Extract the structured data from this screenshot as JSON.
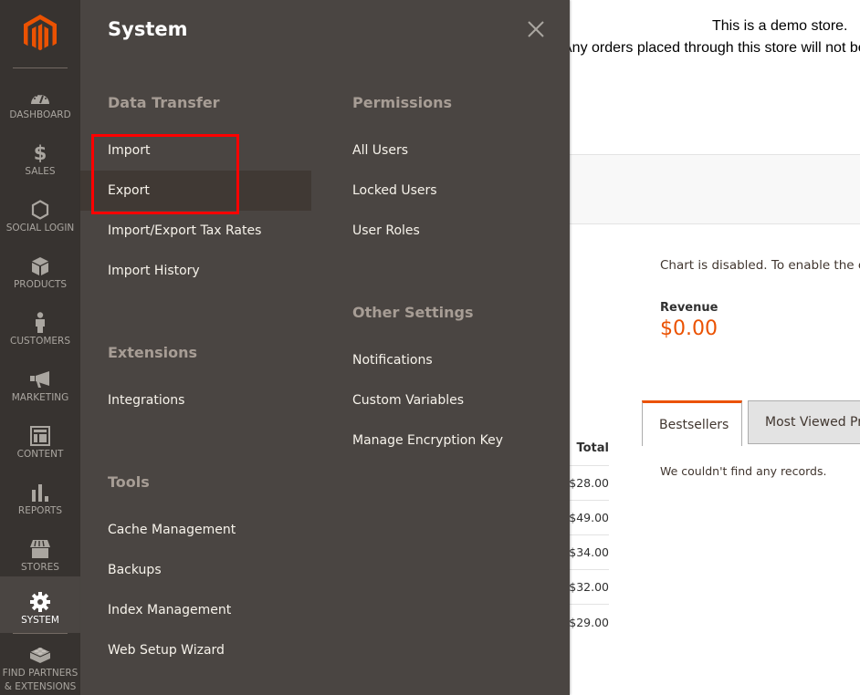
{
  "sidebar": {
    "logo": "magento-logo",
    "items": [
      {
        "label": "Dashboard",
        "icon": "dashboard-icon"
      },
      {
        "label": "Sales",
        "icon": "dollar-icon"
      },
      {
        "label": "Social Login",
        "icon": "hexagon-icon"
      },
      {
        "label": "Products",
        "icon": "box-icon"
      },
      {
        "label": "Customers",
        "icon": "person-icon"
      },
      {
        "label": "Marketing",
        "icon": "megaphone-icon"
      },
      {
        "label": "Content",
        "icon": "layout-icon"
      },
      {
        "label": "Reports",
        "icon": "bar-chart-icon"
      },
      {
        "label": "Stores",
        "icon": "storefront-icon"
      },
      {
        "label": "System",
        "icon": "gear-icon",
        "active": true
      },
      {
        "label_line1": "Find Partners",
        "label_line2": "& Extensions",
        "icon": "lego-brick-icon"
      }
    ]
  },
  "flyout": {
    "title": "System",
    "close_icon": "close-icon",
    "groups": {
      "data_transfer": {
        "title": "Data Transfer",
        "items": [
          "Import",
          "Export",
          "Import/Export Tax Rates",
          "Import History"
        ]
      },
      "extensions": {
        "title": "Extensions",
        "items": [
          "Integrations"
        ]
      },
      "tools": {
        "title": "Tools",
        "items": [
          "Cache Management",
          "Backups",
          "Index Management",
          "Web Setup Wizard"
        ]
      },
      "permissions": {
        "title": "Permissions",
        "items": [
          "All Users",
          "Locked Users",
          "User Roles"
        ]
      },
      "other_settings": {
        "title": "Other Settings",
        "items": [
          "Notifications",
          "Custom Variables",
          "Manage Encryption Key"
        ]
      }
    },
    "hovered_item": "Export",
    "highlighted_items": [
      "Import",
      "Export"
    ]
  },
  "page": {
    "demo_notice_line1": "This is a demo store.",
    "demo_notice_line2": "Any orders placed through this store will not be",
    "chart_message": "Chart is disabled. To enable the ch",
    "revenue_label": "Revenue",
    "revenue_value": "$0.00",
    "totals": {
      "header": "Total",
      "values": [
        "$28.00",
        "$49.00",
        "$34.00",
        "$32.00",
        "$29.00"
      ]
    },
    "tabs": [
      {
        "label": "Bestsellers",
        "active": true
      },
      {
        "label": "Most Viewed Pr",
        "active": false
      }
    ],
    "no_records": "We couldn't find any records."
  },
  "colors": {
    "accent": "#eb5202",
    "sidebar_bg": "#373330",
    "flyout_bg": "#4a4542",
    "highlight_box": "#ff0000"
  }
}
